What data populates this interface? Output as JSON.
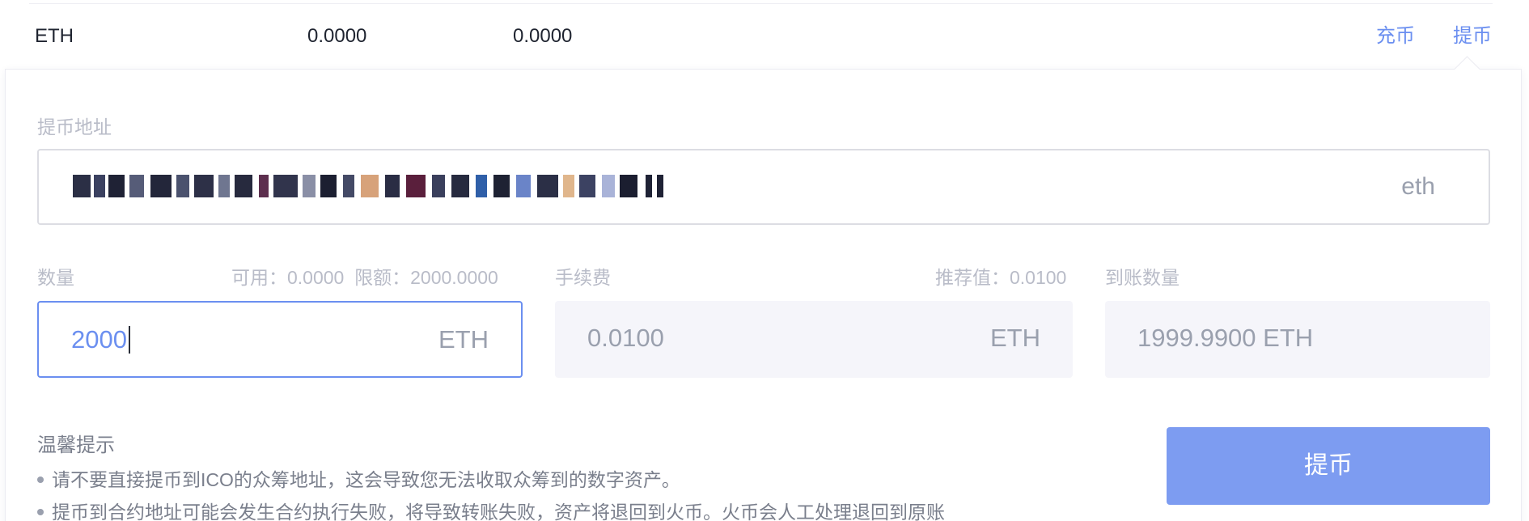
{
  "asset_row": {
    "coin": "ETH",
    "available": "0.0000",
    "frozen": "0.0000",
    "deposit_link": "充币",
    "withdraw_link": "提币"
  },
  "withdraw_form": {
    "address_label": "提币地址",
    "address_unit": "eth",
    "amount_label": "数量",
    "amount_hint": "可用：0.0000  限额：2000.0000",
    "amount_value": "2000",
    "amount_unit": "ETH",
    "fee_label": "手续费",
    "fee_hint": "推荐值：0.0100",
    "fee_value": "0.0100",
    "fee_unit": "ETH",
    "receive_label": "到账数量",
    "receive_value": "1999.9900 ETH"
  },
  "tips": {
    "title": "温馨提示",
    "items": [
      "请不要直接提币到ICO的众筹地址，这会导致您无法收取众筹到的数字资产。",
      "提币到合约地址可能会发生合约执行失败，将导致转账失败，资产将退回到火币。火币会人工处理退回到原账"
    ]
  },
  "submit_label": "提币",
  "colors": {
    "accent": "#6b8ff0",
    "button": "#7d9cf1",
    "label": "#b9bcc8",
    "text": "#1f2430",
    "muted": "#9aa0ae",
    "field_bg": "#f5f5fa"
  }
}
